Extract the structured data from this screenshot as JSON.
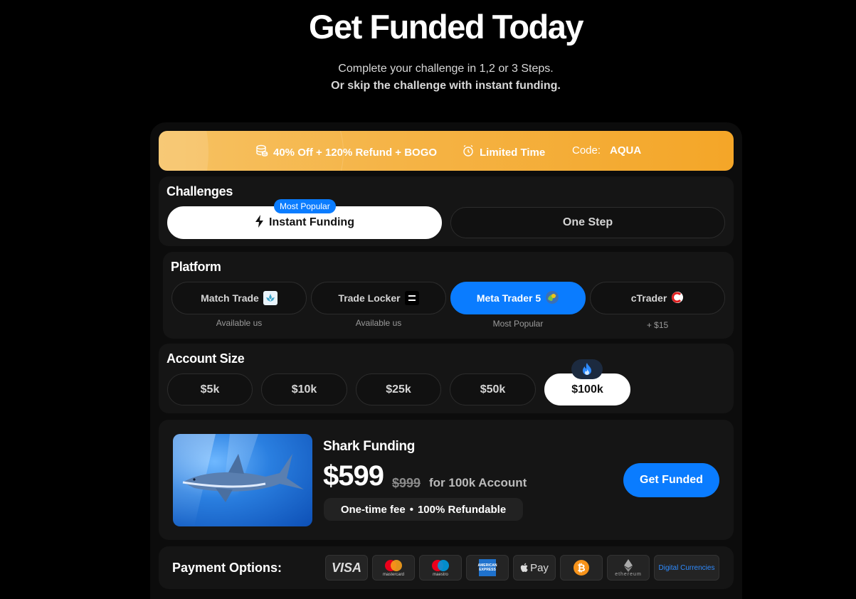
{
  "hero": {
    "title": "Get Funded Today",
    "subtitle_line1": "Complete your challenge in 1,2 or 3 Steps.",
    "subtitle_line2": "Or skip the challenge with instant funding."
  },
  "promo": {
    "offer": "40% Off + 120% Refund + BOGO",
    "limited": "Limited Time",
    "code_label": "Code:",
    "code_value": "AQUA"
  },
  "challenges": {
    "title": "Challenges",
    "badge": "Most Popular",
    "options": [
      "Instant Funding",
      "One Step"
    ],
    "selected": "Instant Funding"
  },
  "platform": {
    "title": "Platform",
    "options": [
      {
        "label": "Match Trade",
        "caption": "Available us"
      },
      {
        "label": "Trade Locker",
        "caption": "Available us"
      },
      {
        "label": "Meta Trader 5",
        "caption": "Most Popular"
      },
      {
        "label": "cTrader",
        "caption": "+ $15"
      }
    ],
    "selected": "Meta Trader 5"
  },
  "account_size": {
    "title": "Account Size",
    "options": [
      "$5k",
      "$10k",
      "$25k",
      "$50k",
      "$100k"
    ],
    "selected": "$100k",
    "hot_icon": "fire-icon"
  },
  "offer": {
    "name": "Shark Funding",
    "price": "$599",
    "old_price": "$999",
    "for_text": "for 100k Account",
    "fee_note_1": "One-time fee",
    "fee_note_2": "100% Refundable",
    "cta": "Get Funded"
  },
  "payment": {
    "label": "Payment Options:",
    "methods": [
      "VISA",
      "mastercard",
      "maestro",
      "AMERICAN EXPRESS",
      "Pay",
      "bitcoin",
      "ethereum",
      "Digital Currencies"
    ]
  },
  "colors": {
    "accent": "#0a7cff",
    "promo": "#f5b447",
    "background": "#000000",
    "card": "#151515"
  }
}
